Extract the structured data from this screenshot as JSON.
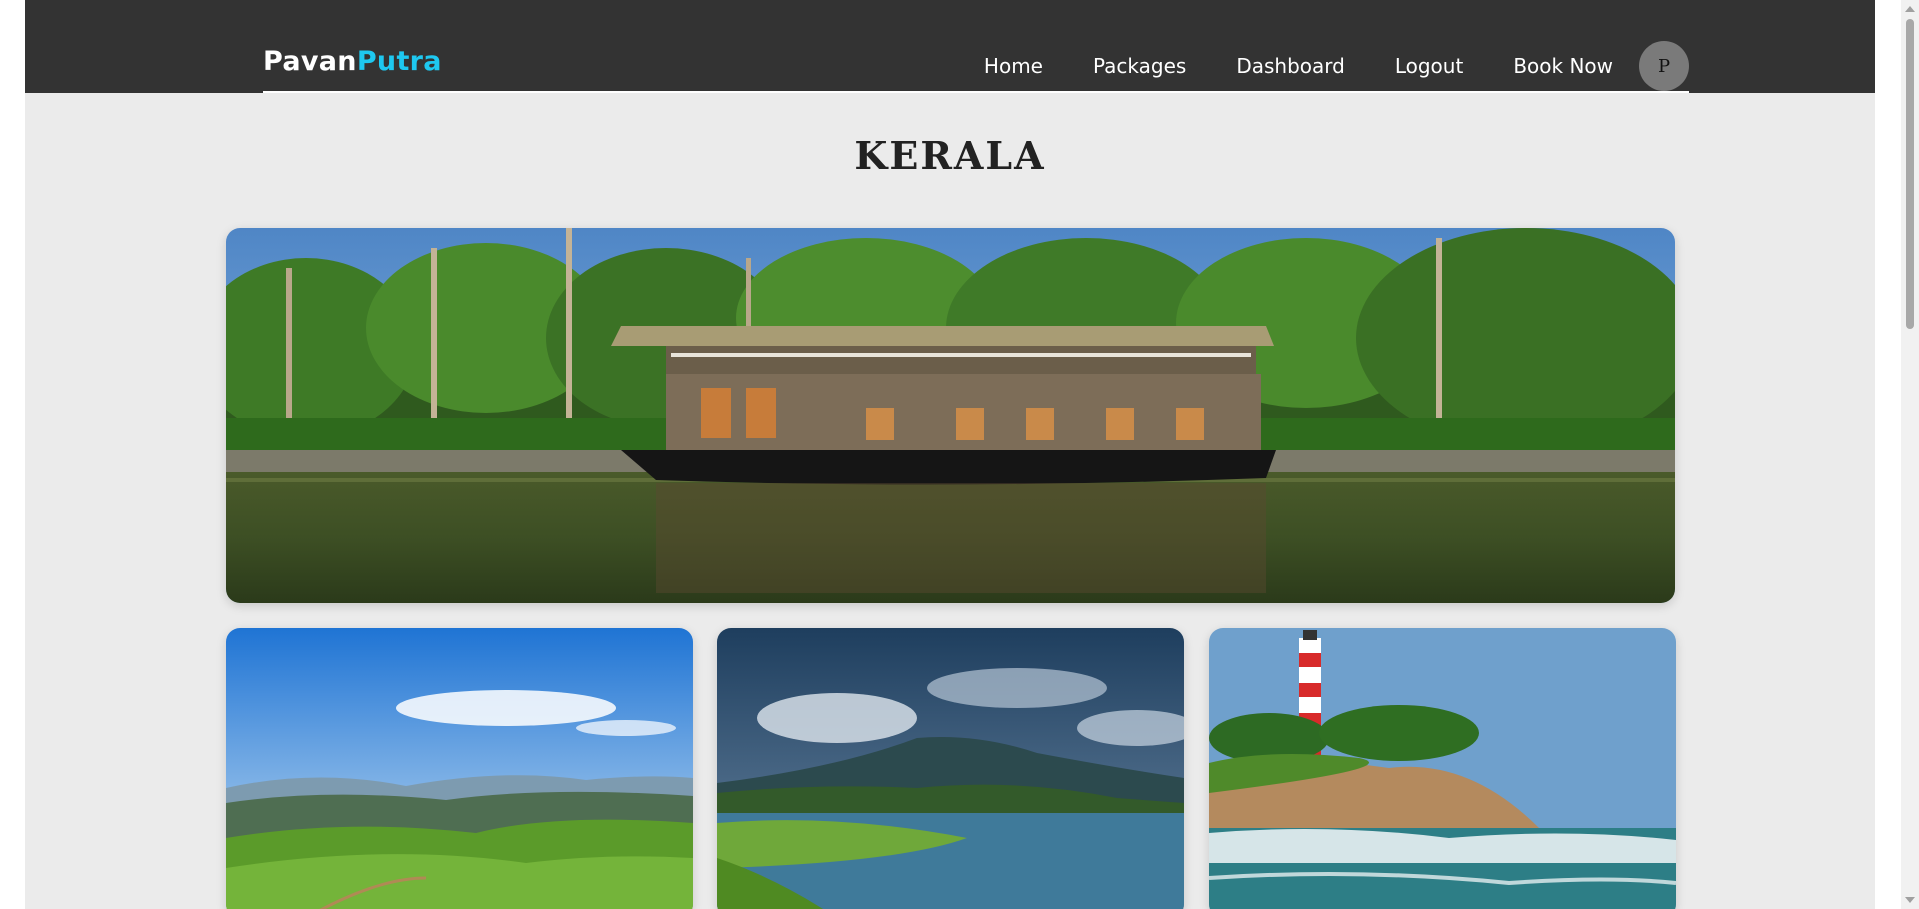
{
  "brand": {
    "name_part1": "Pavan",
    "name_part2": "Putra"
  },
  "nav": {
    "items": [
      {
        "label": "Home"
      },
      {
        "label": "Packages"
      },
      {
        "label": "Dashboard"
      },
      {
        "label": "Logout"
      },
      {
        "label": "Book Now"
      }
    ],
    "avatar_initial": "P"
  },
  "page": {
    "title": "KERALA"
  },
  "gallery": {
    "hero": {
      "image": "kerala-backwater-houseboat"
    },
    "cards": [
      {
        "image": "tea-plantation-hills"
      },
      {
        "image": "mountain-lake-landscape"
      },
      {
        "image": "lighthouse-beach"
      }
    ]
  },
  "colors": {
    "navbar_bg": "#333333",
    "brand_accent": "#1ec8f0",
    "page_bg": "#ebebeb",
    "avatar_bg": "#7a7a7a"
  }
}
